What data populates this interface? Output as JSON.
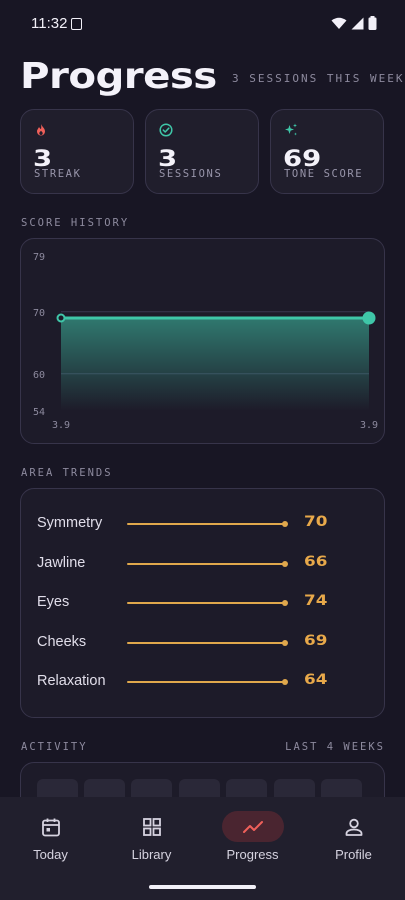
{
  "status_bar": {
    "time": "11:32"
  },
  "header": {
    "title": "Progress",
    "subtitle": "3 SESSIONS THIS WEEK"
  },
  "stats": [
    {
      "icon": "flame-icon",
      "value": "3",
      "label": "STREAK",
      "color": "#f0605a"
    },
    {
      "icon": "check-circle-icon",
      "value": "3",
      "label": "SESSIONS",
      "color": "#3fc6a8"
    },
    {
      "icon": "sparkle-icon",
      "value": "69",
      "label": "TONE SCORE",
      "color": "#3fc6a8"
    }
  ],
  "score_history": {
    "label": "SCORE HISTORY"
  },
  "chart_data": {
    "type": "area",
    "title": "SCORE HISTORY",
    "x": [
      "3.9",
      "3.9"
    ],
    "series": [
      {
        "values": [
          69,
          69
        ]
      }
    ],
    "y_ticks": [
      79,
      70,
      60,
      54
    ],
    "ylim": [
      54,
      79
    ],
    "grid": true,
    "color": "#3fc6a8"
  },
  "area_trends": {
    "label": "AREA TRENDS",
    "max": 100,
    "items": [
      {
        "label": "Symmetry",
        "value": 70
      },
      {
        "label": "Jawline",
        "value": 66
      },
      {
        "label": "Eyes",
        "value": 74
      },
      {
        "label": "Cheeks",
        "value": 69
      },
      {
        "label": "Relaxation",
        "value": 64
      }
    ],
    "color": "#e0a84c"
  },
  "activity": {
    "label": "ACTIVITY",
    "range": "LAST 4 WEEKS"
  },
  "nav": {
    "items": [
      {
        "label": "Today",
        "icon": "calendar-icon"
      },
      {
        "label": "Library",
        "icon": "grid-icon"
      },
      {
        "label": "Progress",
        "icon": "trend-icon",
        "active": true
      },
      {
        "label": "Profile",
        "icon": "person-icon"
      }
    ]
  }
}
